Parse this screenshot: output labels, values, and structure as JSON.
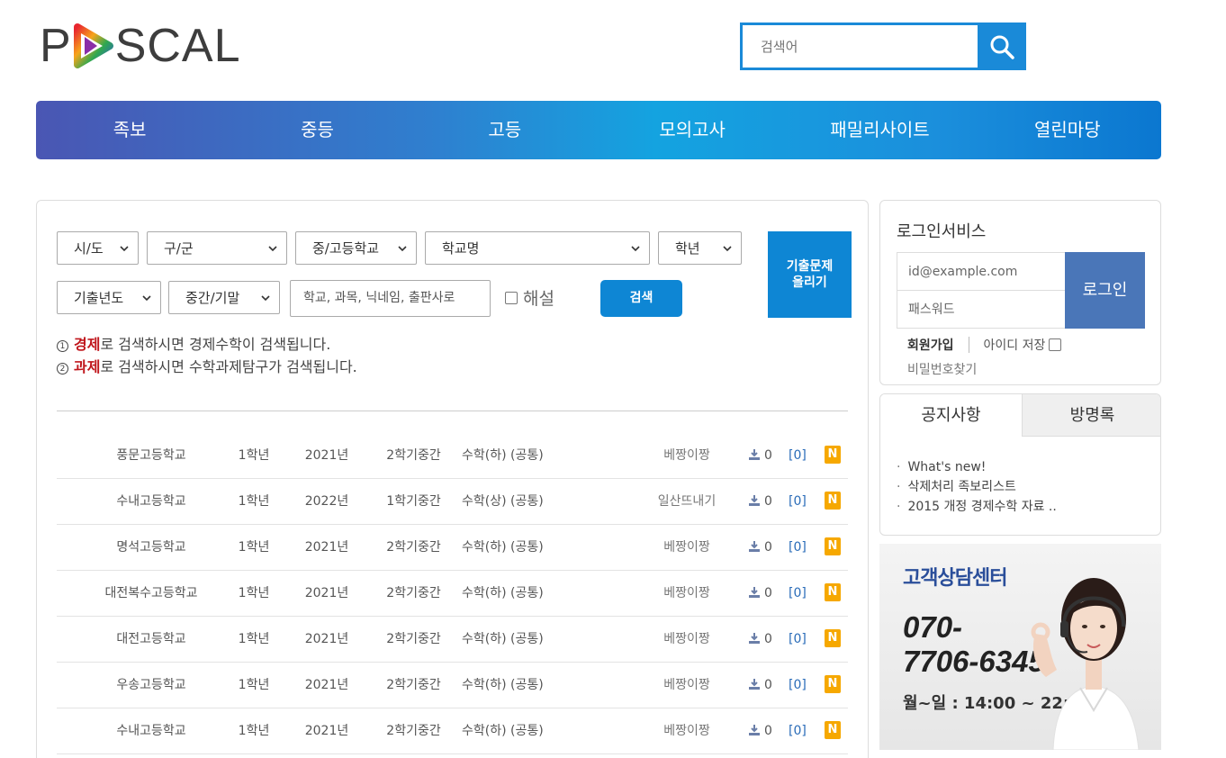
{
  "logo": {
    "letters_before": "P",
    "letters_after": "SCAL"
  },
  "search": {
    "placeholder": "검색어"
  },
  "nav": [
    "족보",
    "중등",
    "고등",
    "모의고사",
    "패밀리사이트",
    "열린마당"
  ],
  "filters": {
    "sido": "시/도",
    "gugun": "구/군",
    "level": "중/고등학교",
    "school": "학교명",
    "grade": "학년",
    "exam_year": "기출년도",
    "term": "중간/기말",
    "keyword_placeholder": "학교, 과목, 닉네임, 출판사로",
    "explain_label": "해설",
    "search_button": "검색",
    "upload_button_line1": "기출문제",
    "upload_button_line2": "올리기"
  },
  "notes": [
    {
      "num": "1",
      "keyword": "경제",
      "text": "로 검색하시면 경제수학이 검색됩니다."
    },
    {
      "num": "2",
      "keyword": "과제",
      "text": "로 검색하시면 수학과제탐구가 검색됩니다."
    }
  ],
  "rows": [
    {
      "school": "풍문고등학교",
      "grade": "1학년",
      "year": "2021년",
      "term": "2학기중간",
      "subject": "수학(하) (공통)",
      "user": "베짱이짱",
      "downloads": "0",
      "comments": "[0]",
      "badge": "N"
    },
    {
      "school": "수내고등학교",
      "grade": "1학년",
      "year": "2022년",
      "term": "1학기중간",
      "subject": "수학(상) (공통)",
      "user": "일산뜨내기",
      "downloads": "0",
      "comments": "[0]",
      "badge": "N"
    },
    {
      "school": "명석고등학교",
      "grade": "1학년",
      "year": "2021년",
      "term": "2학기중간",
      "subject": "수학(하) (공통)",
      "user": "베짱이짱",
      "downloads": "0",
      "comments": "[0]",
      "badge": "N"
    },
    {
      "school": "대전복수고등학교",
      "grade": "1학년",
      "year": "2021년",
      "term": "2학기중간",
      "subject": "수학(하) (공통)",
      "user": "베짱이짱",
      "downloads": "0",
      "comments": "[0]",
      "badge": "N"
    },
    {
      "school": "대전고등학교",
      "grade": "1학년",
      "year": "2021년",
      "term": "2학기중간",
      "subject": "수학(하) (공통)",
      "user": "베짱이짱",
      "downloads": "0",
      "comments": "[0]",
      "badge": "N"
    },
    {
      "school": "우송고등학교",
      "grade": "1학년",
      "year": "2021년",
      "term": "2학기중간",
      "subject": "수학(하) (공통)",
      "user": "베짱이짱",
      "downloads": "0",
      "comments": "[0]",
      "badge": "N"
    },
    {
      "school": "수내고등학교",
      "grade": "1학년",
      "year": "2021년",
      "term": "2학기중간",
      "subject": "수학(하) (공통)",
      "user": "베짱이짱",
      "downloads": "0",
      "comments": "[0]",
      "badge": "N"
    }
  ],
  "login": {
    "title": "로그인서비스",
    "id_placeholder": "id@example.com",
    "pw_placeholder": "패스워드",
    "button": "로그인",
    "join": "회원가입",
    "save_id": "아이디 저장",
    "find_pw": "비밀번호찾기"
  },
  "board": {
    "tab_notice": "공지사항",
    "tab_guestbook": "방명록",
    "items": [
      "What's new!",
      "삭제처리 족보리스트",
      "2015 개정 경제수학 자료 .."
    ]
  },
  "cs": {
    "title": "고객상담센터",
    "phone_line1": "070-",
    "phone_line2": "7706-6345",
    "hours": "월~일 : 14:00 ~ 22:00"
  },
  "colors": {
    "accent": "#0e86d4",
    "nav_start": "#4a56b3",
    "nav_end": "#0b77d0",
    "new_badge": "#f6a800",
    "keyword_red": "#c0161c"
  }
}
